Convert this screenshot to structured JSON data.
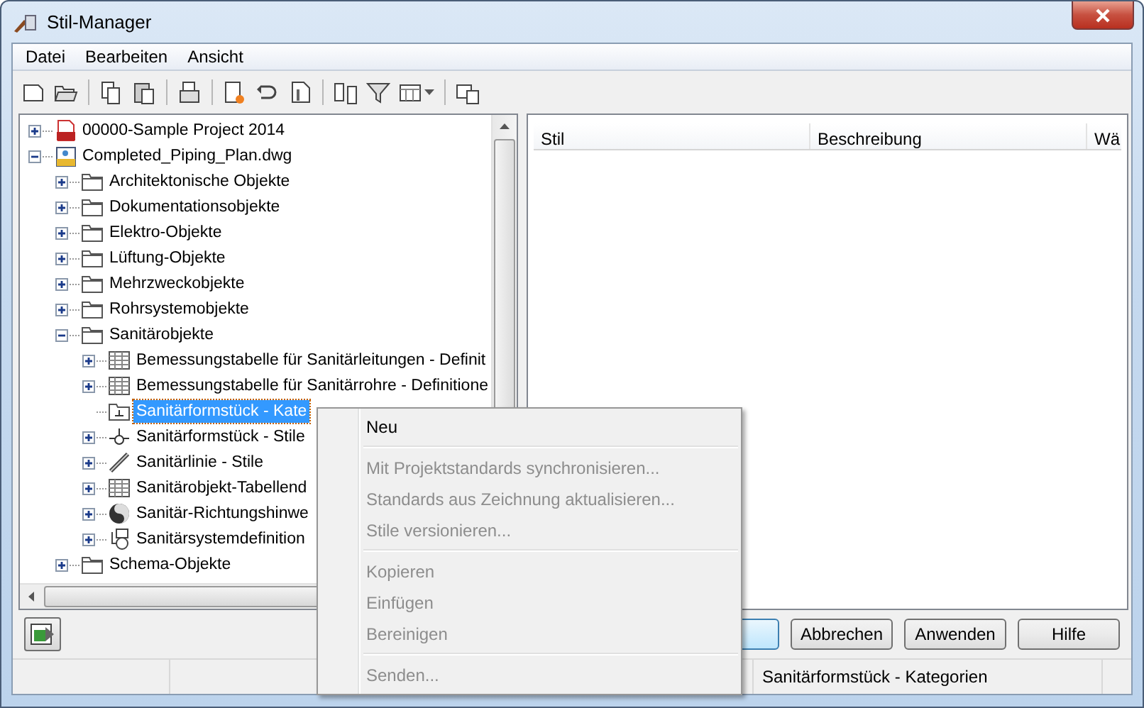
{
  "window": {
    "title": "Stil-Manager"
  },
  "menu_bar": [
    "Datei",
    "Bearbeiten",
    "Ansicht"
  ],
  "tree": [
    {
      "label": "00000-Sample Project 2014",
      "kind": "project",
      "expandable": true,
      "expanded": false,
      "selected": false
    },
    {
      "label": "Completed_Piping_Plan.dwg",
      "kind": "drawing",
      "expandable": true,
      "expanded": true,
      "selected": false,
      "children": [
        {
          "label": "Architektonische Objekte",
          "kind": "folder",
          "expandable": true,
          "expanded": false,
          "selected": false
        },
        {
          "label": "Dokumentationsobjekte",
          "kind": "folder",
          "expandable": true,
          "expanded": false,
          "selected": false
        },
        {
          "label": "Elektro-Objekte",
          "kind": "folder",
          "expandable": true,
          "expanded": false,
          "selected": false
        },
        {
          "label": "Lüftung-Objekte",
          "kind": "folder",
          "expandable": true,
          "expanded": false,
          "selected": false
        },
        {
          "label": "Mehrzweckobjekte",
          "kind": "folder",
          "expandable": true,
          "expanded": false,
          "selected": false
        },
        {
          "label": "Rohrsystemobjekte",
          "kind": "folder",
          "expandable": true,
          "expanded": false,
          "selected": false
        },
        {
          "label": "Sanitärobjekte",
          "kind": "folder",
          "expandable": true,
          "expanded": true,
          "selected": false,
          "children": [
            {
              "label": "Bemessungstabelle für Sanitärleitungen - Definit",
              "kind": "table",
              "expandable": true,
              "expanded": false,
              "selected": false
            },
            {
              "label": "Bemessungstabelle für Sanitärrohre - Definitione",
              "kind": "table",
              "expandable": true,
              "expanded": false,
              "selected": false
            },
            {
              "label": "Sanitärformstück - Kate",
              "kind": "category",
              "selected": true
            },
            {
              "label": "Sanitärformstück - Stile",
              "kind": "fitting",
              "expandable": true,
              "expanded": false,
              "selected": false
            },
            {
              "label": "Sanitärlinie - Stile",
              "kind": "line",
              "expandable": true,
              "expanded": false,
              "selected": false
            },
            {
              "label": "Sanitärobjekt-Tabellend",
              "kind": "table",
              "expandable": true,
              "expanded": false,
              "selected": false
            },
            {
              "label": "Sanitär-Richtungshinwe",
              "kind": "sphere",
              "expandable": true,
              "expanded": false,
              "selected": false
            },
            {
              "label": "Sanitärsystemdefinition",
              "kind": "system",
              "expandable": true,
              "expanded": false,
              "selected": false
            }
          ]
        },
        {
          "label": "Schema-Objekte",
          "kind": "folder",
          "expandable": true,
          "expanded": false,
          "selected": false
        }
      ]
    }
  ],
  "table": {
    "columns": [
      "Stil",
      "Beschreibung",
      "Wä"
    ]
  },
  "buttons": [
    {
      "label": "Abbrechen"
    },
    {
      "label": "Anwenden"
    },
    {
      "label": "Hilfe"
    }
  ],
  "status_bar": {
    "text": "Sanitärformstück - Kategorien"
  },
  "context_menu": [
    {
      "kind": "item",
      "label": "Neu",
      "disabled": false
    },
    {
      "kind": "separator"
    },
    {
      "kind": "item",
      "label": "Mit Projektstandards synchronisieren...",
      "disabled": true
    },
    {
      "kind": "item",
      "label": "Standards aus Zeichnung aktualisieren...",
      "disabled": true
    },
    {
      "kind": "item",
      "label": "Stile versionieren...",
      "disabled": true
    },
    {
      "kind": "separator"
    },
    {
      "kind": "item",
      "label": "Kopieren",
      "disabled": true
    },
    {
      "kind": "item",
      "label": "Einfügen",
      "disabled": true
    },
    {
      "kind": "item",
      "label": "Bereinigen",
      "disabled": true
    },
    {
      "kind": "separator"
    },
    {
      "kind": "item",
      "label": "Senden...",
      "disabled": true
    }
  ]
}
